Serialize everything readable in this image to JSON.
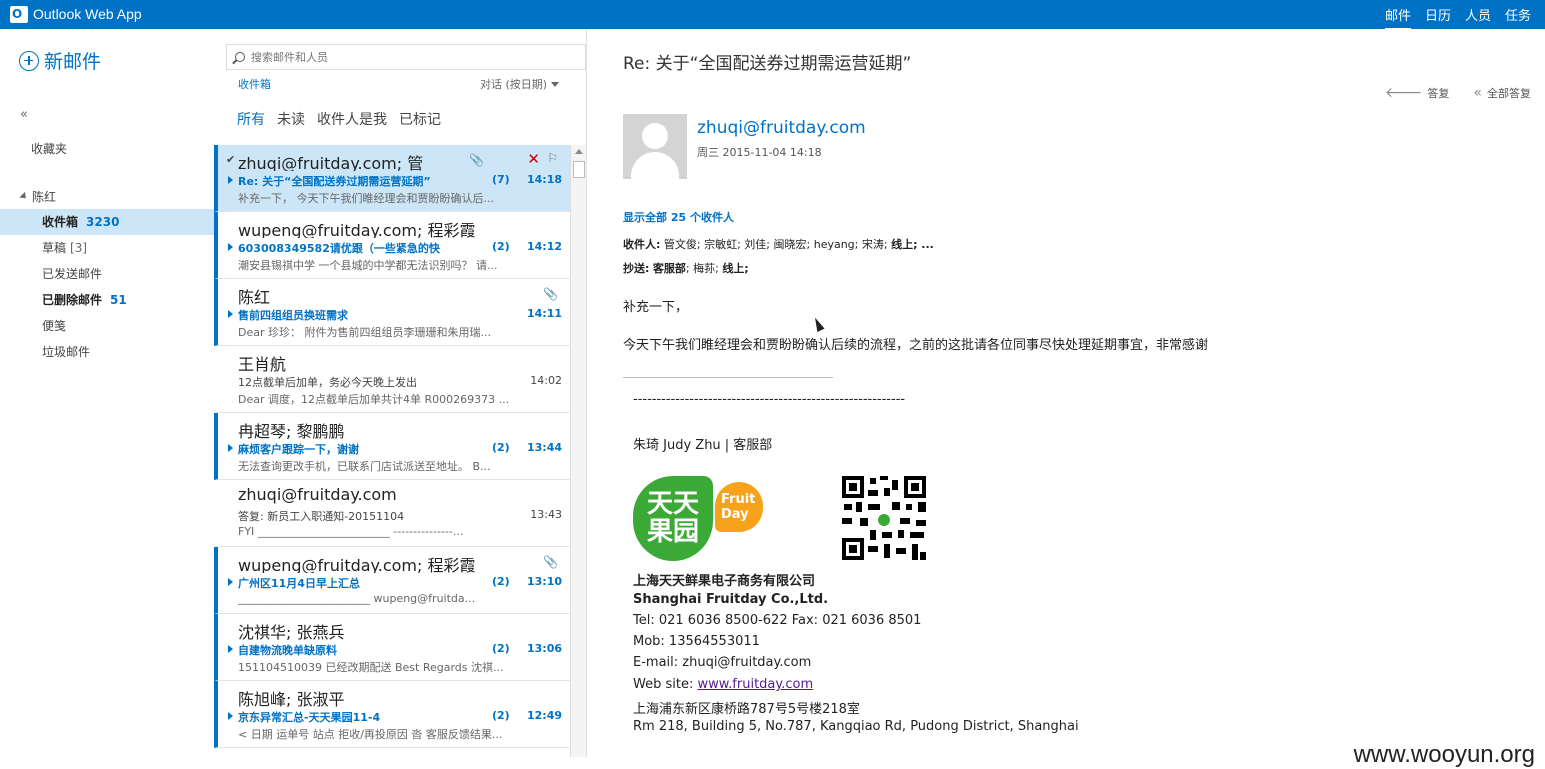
{
  "app": {
    "title": "Outlook Web App"
  },
  "top_nav": [
    "邮件",
    "日历",
    "人员",
    "任务"
  ],
  "left_nav": {
    "new_mail": "新邮件",
    "collapse": "«",
    "favorites": "收藏夹",
    "account": "陈红",
    "folders": [
      {
        "name": "收件箱",
        "count": "3230"
      },
      {
        "name": "草稿",
        "count": "[3]"
      },
      {
        "name": "已发送邮件",
        "count": ""
      },
      {
        "name": "已删除邮件",
        "count": "51"
      },
      {
        "name": "便笺",
        "count": ""
      },
      {
        "name": "垃圾邮件",
        "count": ""
      }
    ]
  },
  "list": {
    "search_placeholder": "搜索邮件和人员",
    "breadcrumb": "收件箱",
    "sort": "对话 (按日期)",
    "filters": [
      "所有",
      "未读",
      "收件人是我",
      "已标记"
    ],
    "messages": [
      {
        "from": "zhuqi@fruitday.com; 管",
        "subject": "Re: 关于“全国配送券过期需运营延期”",
        "count": "(7)",
        "time": "14:18",
        "preview": "补充一下，   今天下午我们睢经理会和贾盼盼确认后..."
      },
      {
        "from": "wupeng@fruitday.com; 程彩霞",
        "subject": "603008349582请优跟（一些紧急的快",
        "count": "(2)",
        "time": "14:12",
        "preview": "潮安县锡祺中学 一个县城的中学都无法识别吗？ 请..."
      },
      {
        "from": "陈红",
        "subject": "售前四组组员换班需求",
        "count": "",
        "time": "14:11",
        "preview": "Dear 珍珍：  附件为售前四组组员李珊珊和朱用瑞..."
      },
      {
        "from": "王肖航",
        "subject": "12点截单后加单，务必今天晚上发出",
        "count": "",
        "time": "14:02",
        "preview": "Dear 调度，12点截单后加单共计4单 R000269373 ..."
      },
      {
        "from": "冉超琴; 黎鹏鹏",
        "subject": "麻烦客户跟踪一下，谢谢",
        "count": "(2)",
        "time": "13:44",
        "preview": "无法查询更改手机，已联系门店试派送至地址。    B..."
      },
      {
        "from": "zhuqi@fruitday.com",
        "subject": "答复: 新员工入职通知-20151104",
        "count": "",
        "time": "13:43",
        "preview": "FYI  ________________________  ---------------..."
      },
      {
        "from": "wupeng@fruitday.com; 程彩霞",
        "subject": "广州区11月4日早上汇总",
        "count": "(2)",
        "time": "13:10",
        "preview": "________________________  wupeng@fruitda..."
      },
      {
        "from": "沈祺华; 张燕兵",
        "subject": "自建物流晚单缺原料",
        "count": "(2)",
        "time": "13:06",
        "preview": "151104510039 已经改期配送   Best Regards 沈祺..."
      },
      {
        "from": "陈旭峰; 张淑平",
        "subject": "京东异常汇总-天天果园11-4",
        "count": "(2)",
        "time": "12:49",
        "preview": "< 日期 运单号 站点 拒收/再投原因 沓 客服反馈结果..."
      }
    ]
  },
  "reading": {
    "subject": "Re: 关于“全国配送券过期需运营延期”",
    "reply": "答复",
    "reply_all": "全部答复",
    "sender": "zhuqi@fruitday.com",
    "date": "周三 2015-11-04 14:18",
    "show_all_recipients": "显示全部 25 个收件人",
    "to_label": "收件人:",
    "to_names": "管文俊;  宗敏虹;  刘佳;  闽晓宏;  heyang;  宋涛; ",
    "to_bold": "线上; ...",
    "cc_label": "抄送:",
    "cc_first": "客服部",
    "cc_names": ";  梅荪; ",
    "cc_bold": "线上;",
    "body_1": "补充一下，",
    "body_2": "今天下午我们睢经理会和贾盼盼确认后续的流程，之前的这批请各位同事尽快处理延期事宜，非常感谢",
    "sig_dashes": "----------------------------------------------------------",
    "sig_name": "朱琦 Judy Zhu | 客服部",
    "logo_text": "天天果园",
    "logo_badge": "Fruit Day",
    "company_cn": "上海天天鲜果电子商务有限公司",
    "company_en": "Shanghai Fruitday Co.,Ltd.",
    "tel": "Tel: 021 6036 8500-622     Fax: 021 6036 8501",
    "mob": "Mob: 13564553011",
    "email": "E-mail: zhuqi@fruitday.com",
    "web_label": "Web site: ",
    "web_link": "www.fruitday.com",
    "addr_cn": "上海浦东新区康桥路787号5号楼218室",
    "addr_en": "Rm 218, Building 5, No.787, Kangqiao Rd, Pudong District, Shanghai"
  },
  "watermark": "www.wooyun.org",
  "colors": {
    "brand": "#0072c6",
    "selected_bg": "#cde6f7",
    "logo_green": "#3aa935",
    "logo_orange": "#f7a21b"
  }
}
